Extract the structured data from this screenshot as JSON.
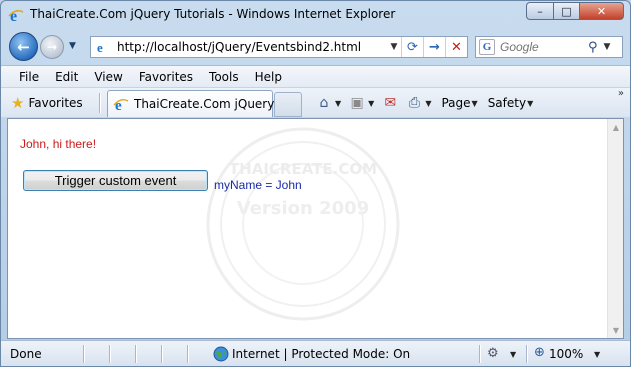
{
  "window": {
    "title": "ThaiCreate.Com jQuery Tutorials - Windows Internet Explorer",
    "controls": {
      "minimize": "–",
      "maximize": "□",
      "close": "✕"
    }
  },
  "nav": {
    "back_glyph": "←",
    "forward_glyph": "→",
    "history_dropdown": "▼",
    "address": "http://localhost/jQuery/Eventsbind2.html",
    "address_dropdown": "▼",
    "refresh_glyph": "⟳",
    "go_glyph": "→",
    "stop_glyph": "✕",
    "search_placeholder": "Google",
    "search_provider_letter": "G",
    "search_go_glyph": "⚲",
    "search_dropdown": "▼"
  },
  "menu": {
    "items": [
      "File",
      "Edit",
      "View",
      "Favorites",
      "Tools",
      "Help"
    ]
  },
  "command_bar": {
    "favorites_label": "Favorites",
    "tab_label": "ThaiCreate.Com jQuery ...",
    "page_label": "Page",
    "safety_label": "Safety",
    "dropdown_glyph": "▼",
    "more_glyph": "»"
  },
  "content": {
    "message": "John, hi there!",
    "trigger_button": "Trigger custom event",
    "output": "myName = John",
    "watermark_line1": "THAICREATE.COM",
    "watermark_line2": "Version 2009"
  },
  "status": {
    "text": "Done",
    "zone": "Internet | Protected Mode: On",
    "zoom": "100%",
    "dropdown_glyph": "▼"
  },
  "colors": {
    "message": "#cc1a1a",
    "output": "#1a2aa8",
    "chrome": "#c9dcef"
  }
}
